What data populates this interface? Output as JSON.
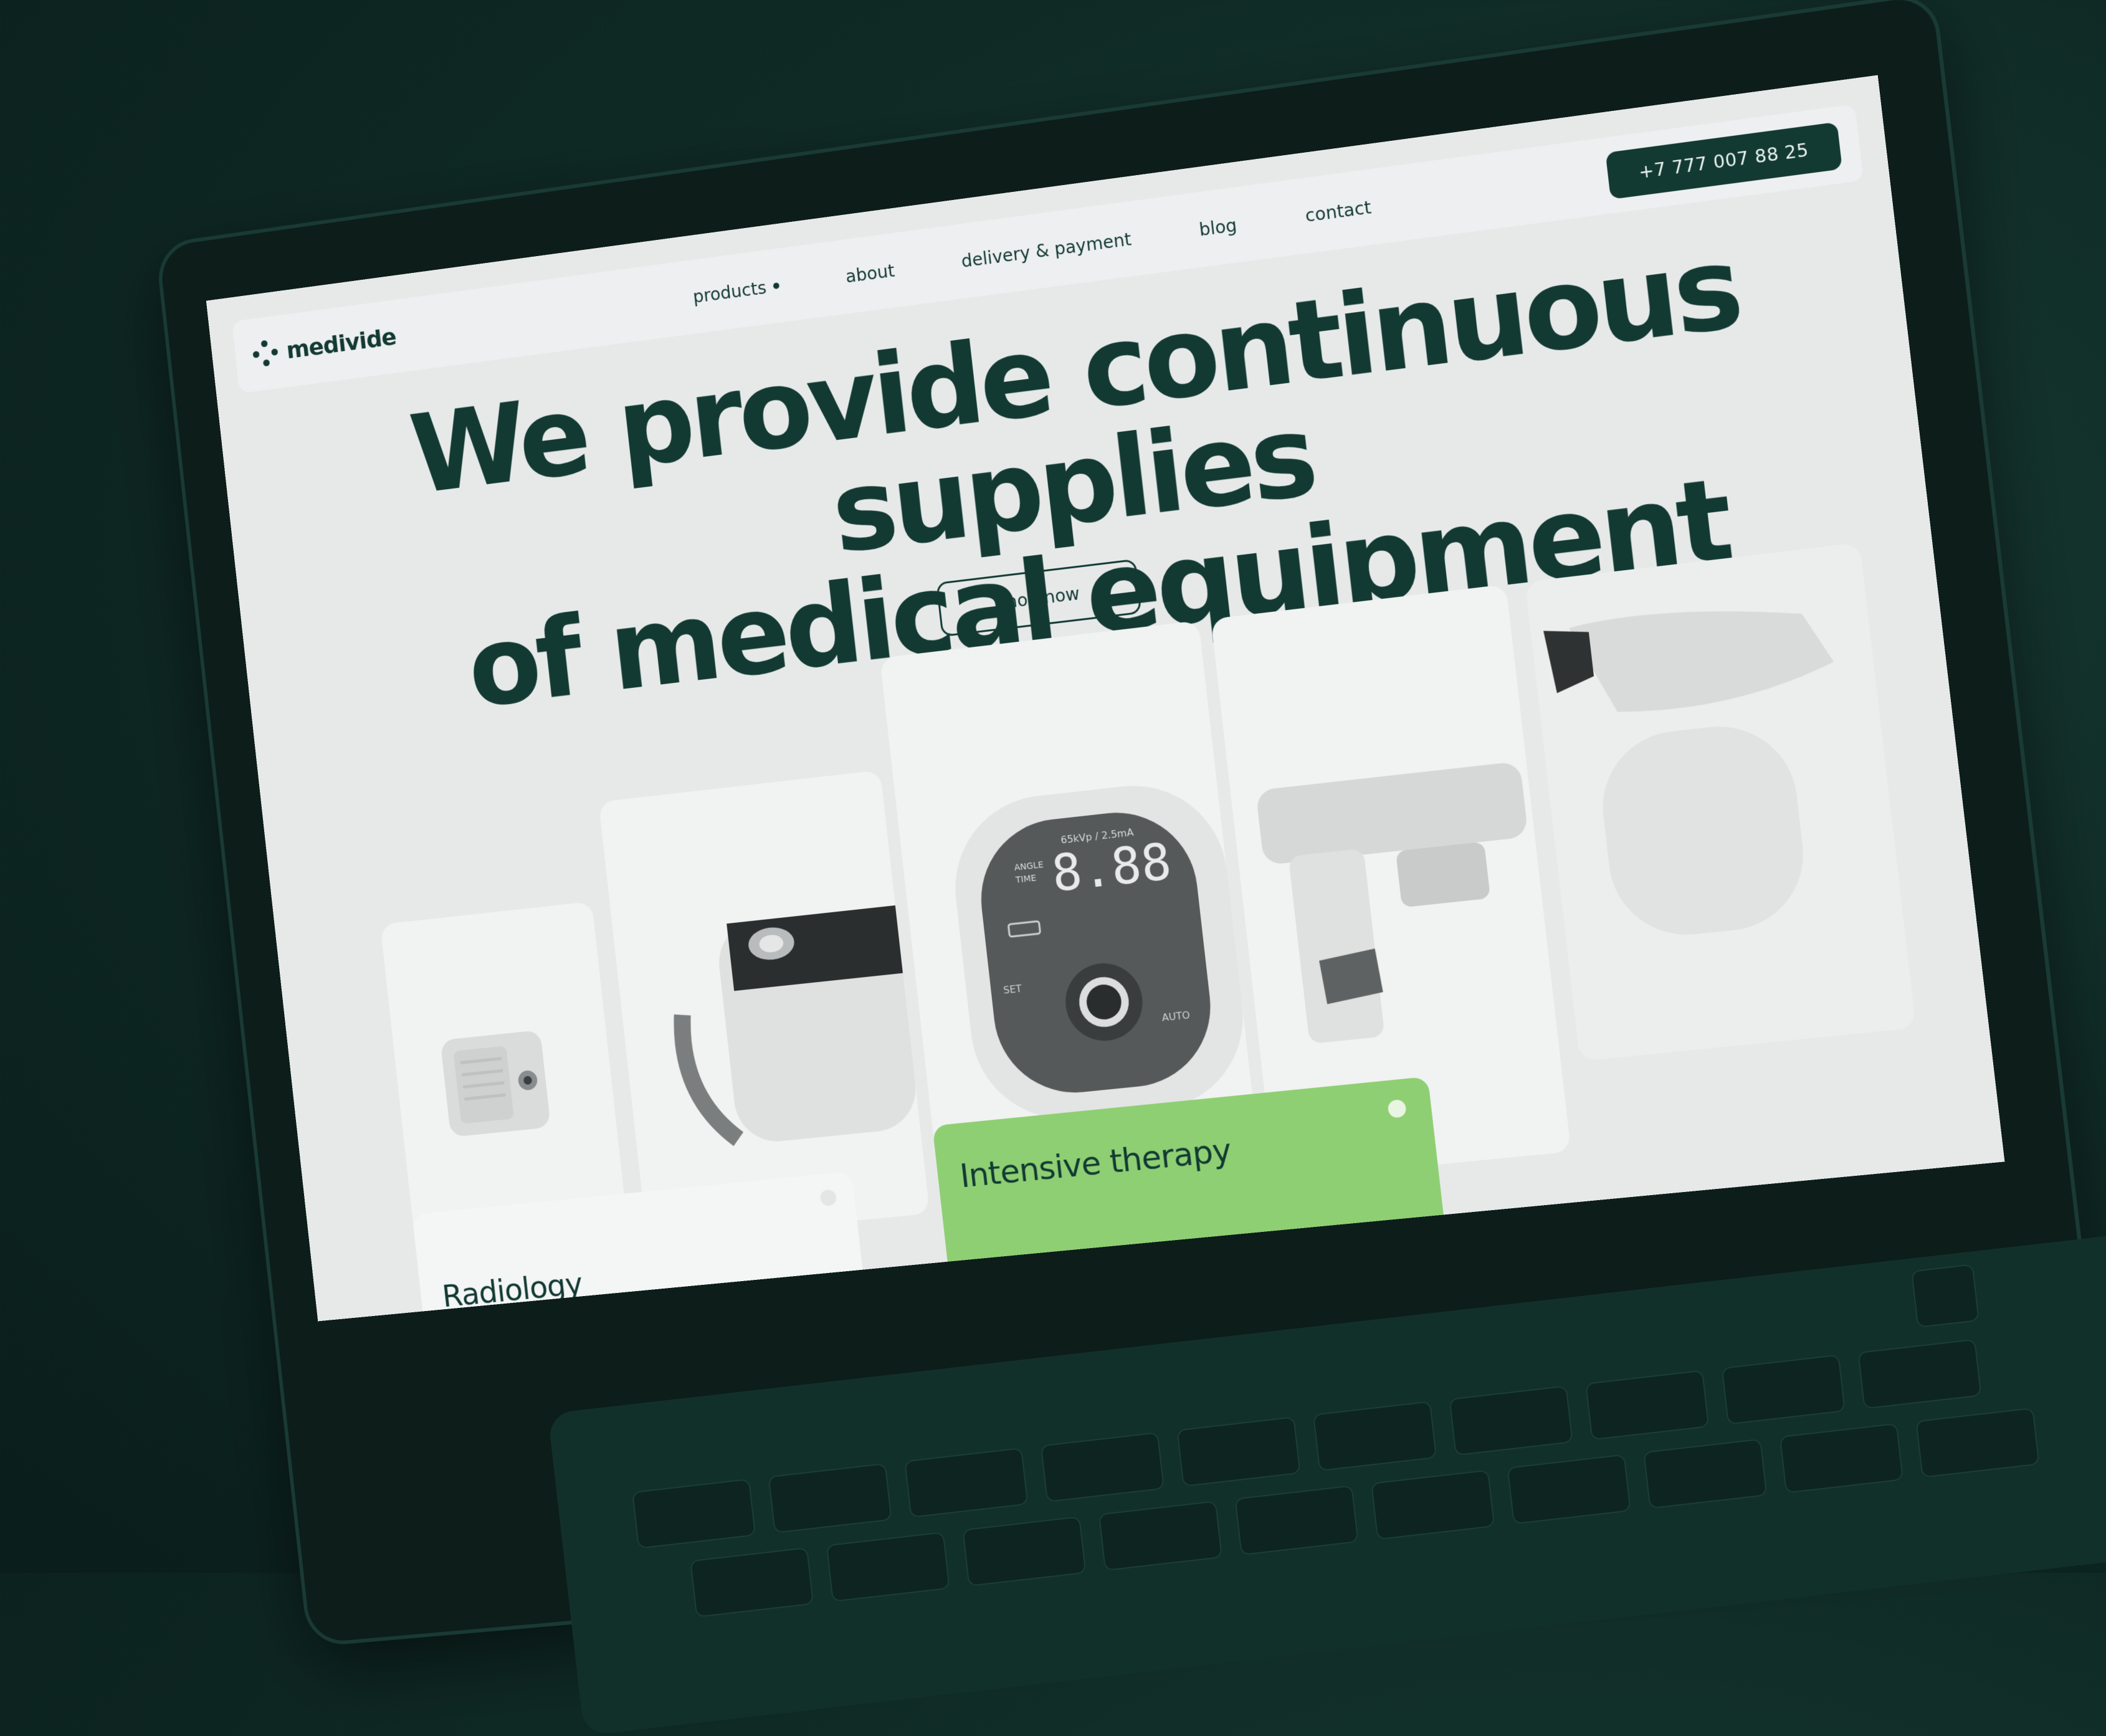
{
  "brand": {
    "name": "medivide",
    "dark": "#123a33",
    "accent": "#8fcf73",
    "screen_bg": "#e7e9e9"
  },
  "nav": {
    "items": [
      {
        "label": "products"
      },
      {
        "label": "about"
      },
      {
        "label": "delivery & payment"
      },
      {
        "label": "blog"
      },
      {
        "label": "contact"
      }
    ]
  },
  "header": {
    "phone": "+7 777 007 88 25"
  },
  "hero": {
    "line1": "We provide continuous supplies",
    "line2": "of medical equipment",
    "cta": "shop now"
  },
  "categories": {
    "radiology": "Radiology",
    "therapy": "Intensive therapy"
  },
  "display": {
    "readout": "8.88",
    "spec": "65kVp / 2.5mA",
    "labels": [
      "ANGLE",
      "TIME"
    ],
    "buttons": [
      "SET",
      "AUTO"
    ]
  }
}
